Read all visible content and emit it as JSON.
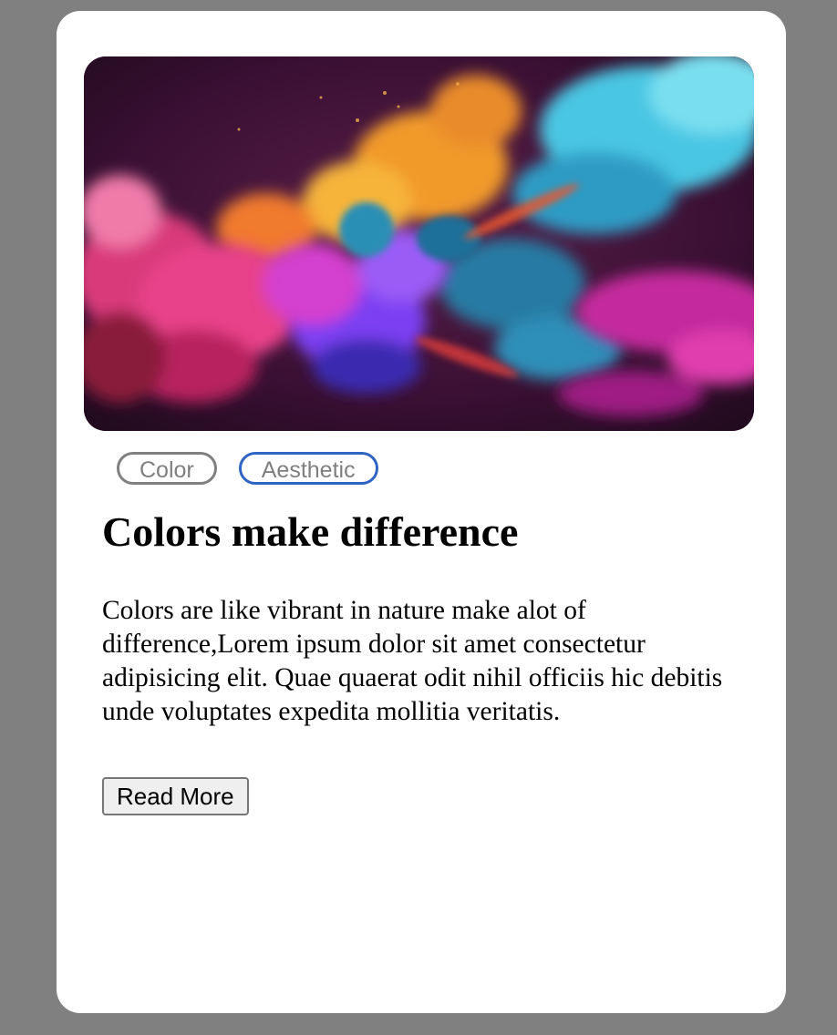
{
  "card": {
    "image_description_icon": "colorful-powder-explosion-image",
    "tags": [
      {
        "label": "Color",
        "border_color": "#808080"
      },
      {
        "label": "Aesthetic",
        "border_color": "#2f63c4"
      }
    ],
    "title": "Colors make difference",
    "description": "Colors are like vibrant in nature make alot of difference,Lorem ipsum dolor sit amet consectetur adipisicing elit. Quae quaerat odit nihil officiis hic debitis unde voluptates expedita mollitia veritatis.",
    "button_label": "Read More"
  },
  "colors": {
    "page_background": "#808080",
    "card_background": "#ffffff"
  }
}
